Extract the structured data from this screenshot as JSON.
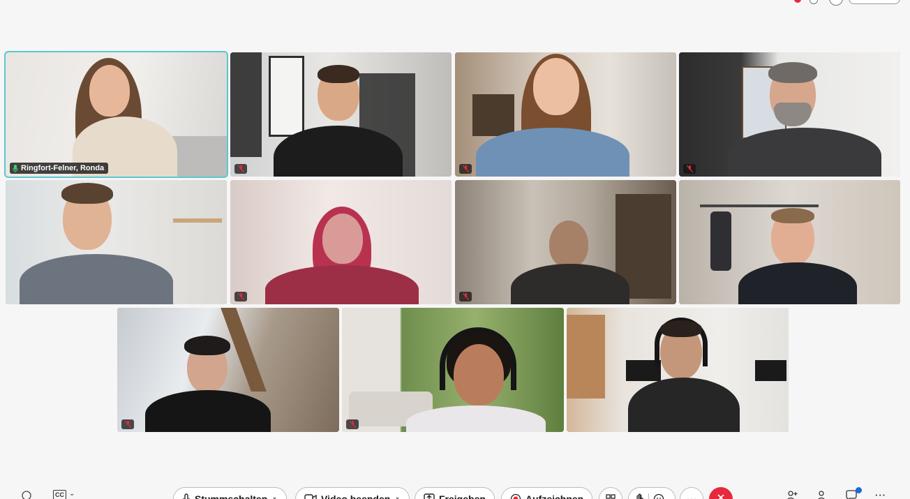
{
  "window": {
    "active_speaker": "Ringfort-Felner, Ronda"
  },
  "participants": [
    {
      "name": "Ringfort-Felner, Ronda",
      "muted": false,
      "active": true
    },
    {
      "name": "",
      "muted": true,
      "active": false
    },
    {
      "name": "",
      "muted": true,
      "active": false
    },
    {
      "name": "",
      "muted": true,
      "active": false
    },
    {
      "name": "",
      "muted": false,
      "active": false
    },
    {
      "name": "",
      "muted": true,
      "active": false
    },
    {
      "name": "",
      "muted": true,
      "active": false
    },
    {
      "name": "",
      "muted": false,
      "active": false
    },
    {
      "name": "",
      "muted": true,
      "active": false
    },
    {
      "name": "",
      "muted": true,
      "active": false
    },
    {
      "name": "",
      "muted": false,
      "active": false
    }
  ],
  "toolbar": {
    "mute_label": "Stummschalten",
    "video_label": "Video beenden",
    "share_label": "Freigeben",
    "record_label": "Aufzeichnen",
    "cc_label": "CC"
  },
  "colors": {
    "active_border": "#5cc6d0",
    "end_call": "#e8283b",
    "record_red": "#e8283b",
    "notify_blue": "#1f6ad6"
  },
  "icons": {
    "mic": "mic-icon",
    "mic_muted": "mic-muted-icon",
    "video": "video-icon",
    "share": "share-icon",
    "record": "record-icon",
    "layout": "layout-icon",
    "reactions": "reactions-icon",
    "more": "more-icon",
    "end": "end-call-icon",
    "add_person": "add-person-icon",
    "participants": "participants-icon",
    "chat": "chat-icon"
  }
}
